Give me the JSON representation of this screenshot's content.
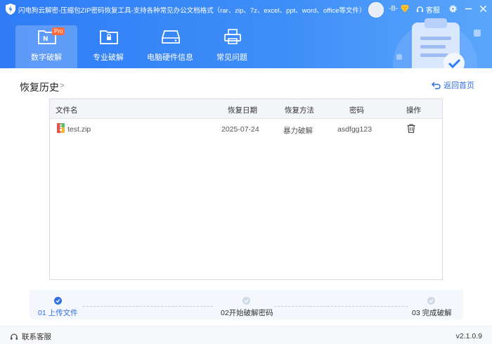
{
  "app": {
    "title": "闪电狗云解密-压缩包ZIP密码恢复工具-支持各种常见办公文档格式（rar、zip、7z、excel、ppt、word、office等文件）",
    "user_name": "-B-",
    "service_label": "客服"
  },
  "tabs": [
    {
      "label": "数字破解",
      "badge": "Pro",
      "active": true
    },
    {
      "label": "专业破解"
    },
    {
      "label": "电脑硬件信息"
    },
    {
      "label": "常见问题"
    }
  ],
  "page": {
    "title": "恢复历史",
    "crumb_arrow": ">",
    "back_label": "返回首页"
  },
  "table": {
    "headers": [
      "文件名",
      "恢复日期",
      "恢复方法",
      "密码",
      "操作"
    ],
    "rows": [
      {
        "file": "test.zip",
        "date": "2025-07-24",
        "method": "暴力破解",
        "password": "asdfgg123"
      }
    ]
  },
  "steps": [
    {
      "label": "01 上传文件",
      "active": true
    },
    {
      "label": "02开始破解密码",
      "active": false
    },
    {
      "label": "03 完成破解",
      "active": false
    }
  ],
  "footer": {
    "contact": "联系客服",
    "version": "v2.1.0.9"
  },
  "colors": {
    "header_blue": "#2f7cf6",
    "accent": "#2f6fe3",
    "pro_badge": "#ff6a3a"
  }
}
